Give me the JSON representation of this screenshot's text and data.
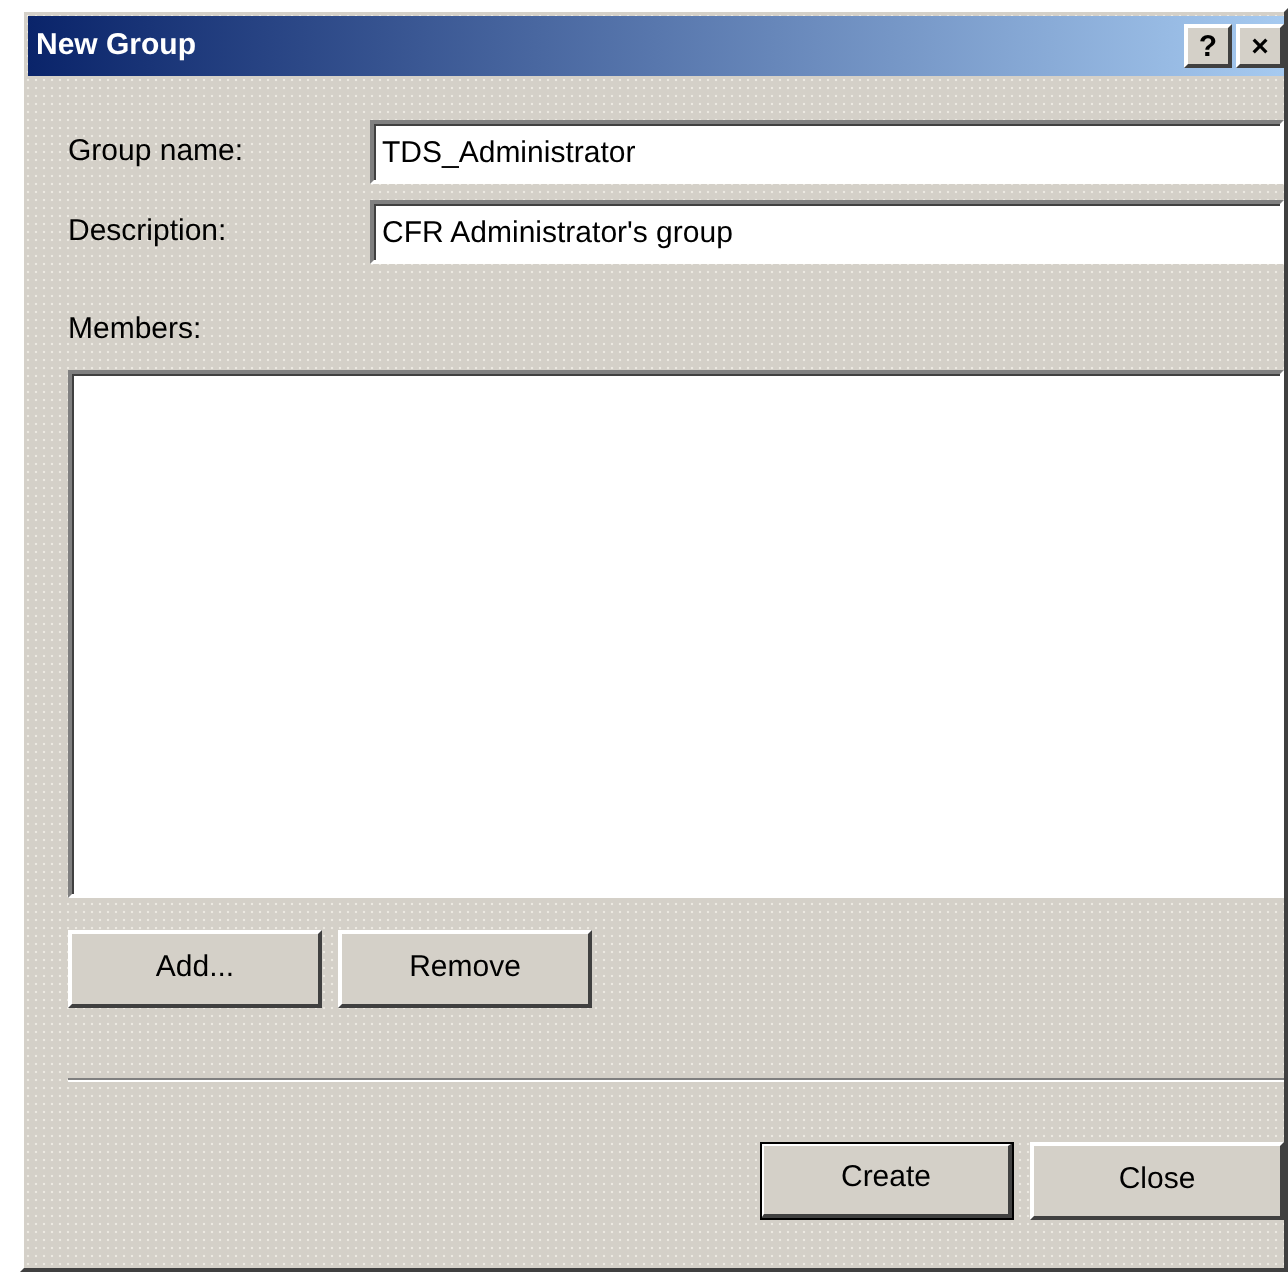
{
  "window": {
    "title": "New Group",
    "title_buttons": [
      "?",
      "×"
    ]
  },
  "fields": [
    {
      "label": "Group name:",
      "value": "TDS_Administrator"
    },
    {
      "label": "Description:",
      "value": "CFR Administrator's group"
    }
  ],
  "members": {
    "label": "Members:"
  },
  "member_buttons": [
    {
      "label": "Add...",
      "default": false
    },
    {
      "label": "Remove",
      "default": false
    }
  ],
  "footer_buttons": [
    {
      "label": "Create",
      "default": true
    },
    {
      "label": "Close",
      "default": false
    }
  ]
}
